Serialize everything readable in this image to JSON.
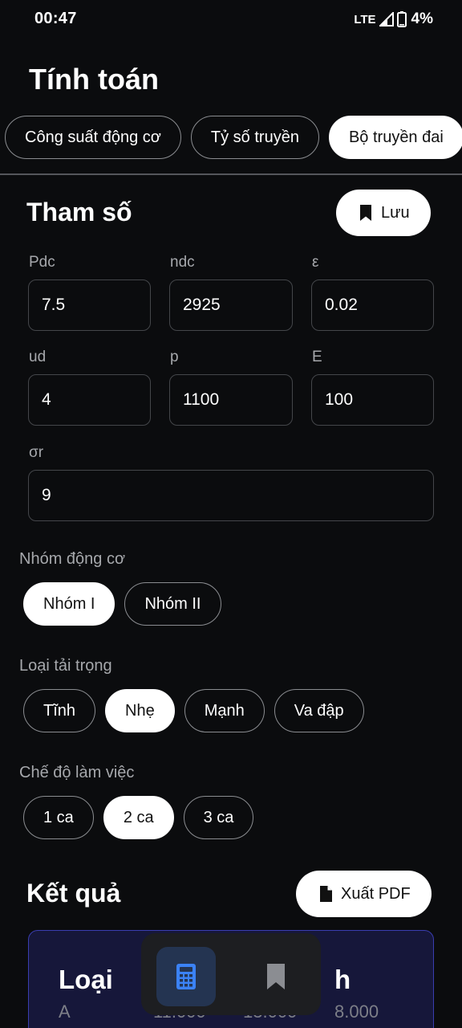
{
  "status": {
    "time": "00:47",
    "network": "LTE",
    "battery": "4%"
  },
  "page_title": "Tính toán",
  "tabs": [
    {
      "label": "Công suất động cơ",
      "active": false
    },
    {
      "label": "Tỷ số truyền",
      "active": false
    },
    {
      "label": "Bộ truyền đai",
      "active": true
    }
  ],
  "params": {
    "title": "Tham số",
    "save_label": "Lưu",
    "fields": [
      {
        "label": "Pdc",
        "value": "7.5"
      },
      {
        "label": "ndc",
        "value": "2925"
      },
      {
        "label": "ε",
        "value": "0.02"
      },
      {
        "label": "ud",
        "value": "4"
      },
      {
        "label": "p",
        "value": "1100"
      },
      {
        "label": "E",
        "value": "100"
      },
      {
        "label": "σr",
        "value": "9"
      }
    ]
  },
  "engine_group": {
    "label": "Nhóm động cơ",
    "options": [
      {
        "label": "Nhóm I",
        "active": true
      },
      {
        "label": "Nhóm II",
        "active": false
      }
    ]
  },
  "load_type": {
    "label": "Loại tải trọng",
    "options": [
      {
        "label": "Tĩnh",
        "active": false
      },
      {
        "label": "Nhẹ",
        "active": true
      },
      {
        "label": "Mạnh",
        "active": false
      },
      {
        "label": "Va đập",
        "active": false
      }
    ]
  },
  "work_mode": {
    "label": "Chế độ làm việc",
    "options": [
      {
        "label": "1 ca",
        "active": false
      },
      {
        "label": "2 ca",
        "active": true
      },
      {
        "label": "3 ca",
        "active": false
      }
    ]
  },
  "results": {
    "title": "Kết quả",
    "export_label": "Xuất PDF",
    "card": {
      "col1_head": "Loại",
      "col1_value": "A",
      "col2_value": "11.000",
      "col3_value": "13.000",
      "col4_head": "h",
      "col4_value": "8.000"
    }
  },
  "nav": {
    "items": [
      {
        "icon": "calculator-icon",
        "active": true
      },
      {
        "icon": "bookmark-icon",
        "active": false
      }
    ]
  },
  "colors": {
    "accent": "#3b82f6",
    "card_border": "#3a3db0"
  }
}
